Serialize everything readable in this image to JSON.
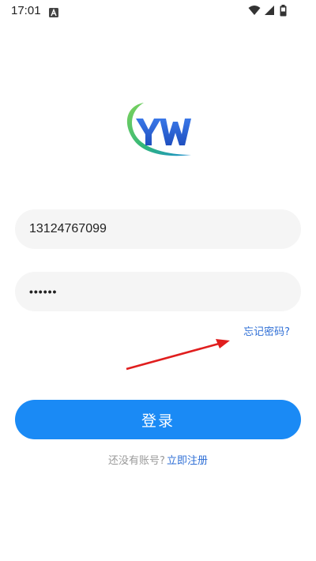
{
  "status_bar": {
    "time": "17:01",
    "notification_icon": "a-app-icon",
    "wifi_icon": "wifi-icon",
    "signal_icon": "signal-icon",
    "battery_icon": "battery-icon"
  },
  "logo": {
    "text": "YW",
    "icon": "yw-logo-icon",
    "colors": {
      "swoosh_green": "#3fbf6a",
      "letters_blue": "#2a5bd7"
    }
  },
  "login_form": {
    "phone_value": "13124767099",
    "password_value": "••••••",
    "forgot_password_label": "忘记密码?",
    "login_button_label": "登录",
    "register_prompt": "还没有账号?",
    "register_link_label": "立即注册"
  },
  "annotation": {
    "icon": "red-arrow-icon",
    "color": "#e01e1e"
  },
  "colors": {
    "primary": "#1a8af5",
    "link": "#2f6fd6",
    "field_bg": "#f5f5f5",
    "muted_text": "#9a9a9a"
  }
}
